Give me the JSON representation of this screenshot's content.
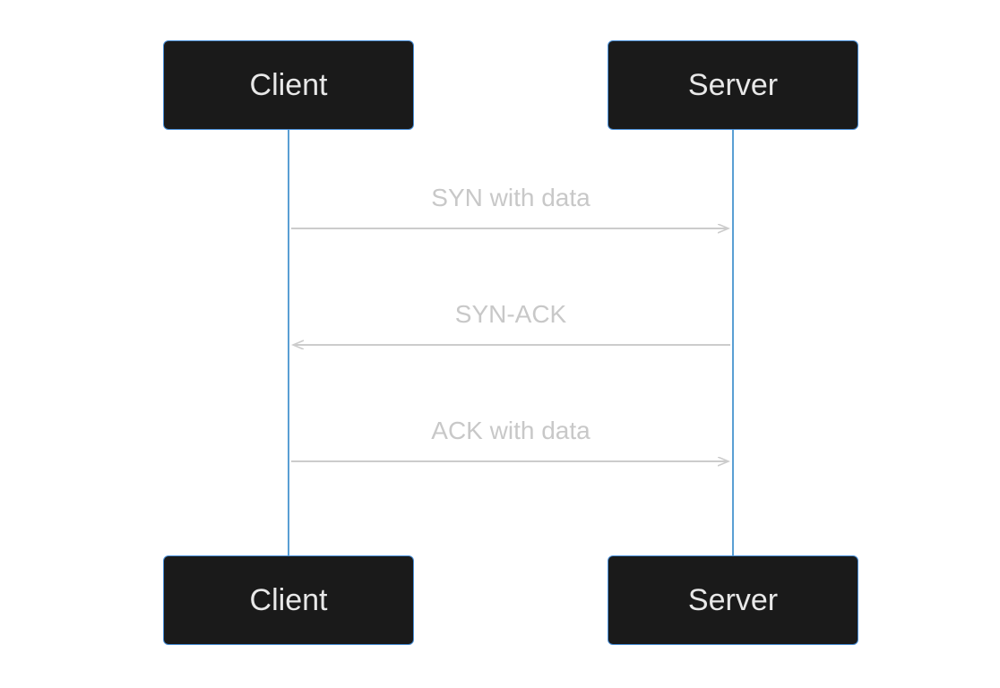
{
  "diagram": {
    "type": "sequence",
    "actors": {
      "left": "Client",
      "right": "Server"
    },
    "messages": [
      {
        "label": "SYN with data",
        "from": "left",
        "to": "right"
      },
      {
        "label": "SYN-ACK",
        "from": "right",
        "to": "left"
      },
      {
        "label": "ACK with data",
        "from": "left",
        "to": "right"
      }
    ],
    "colors": {
      "boxFill": "#1a1a1a",
      "boxBorder": "#4a90d9",
      "boxText": "#e8e8e8",
      "lifeline": "#5a9fd4",
      "arrow": "#cccccc",
      "msgText": "#c8c8c8"
    }
  }
}
